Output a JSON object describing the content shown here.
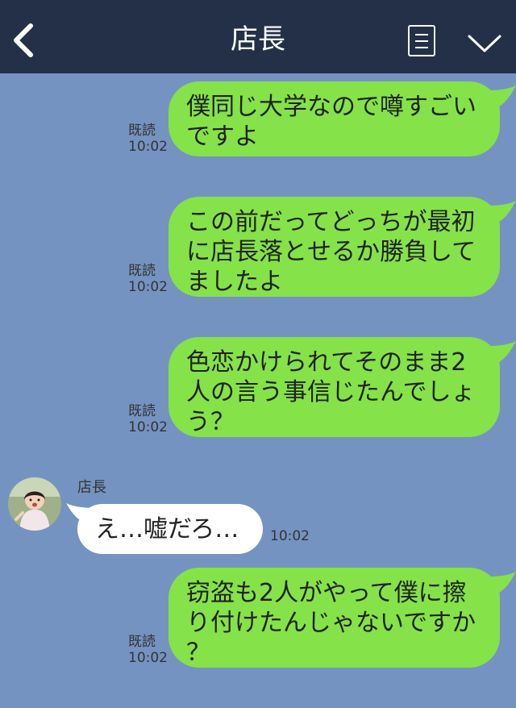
{
  "header": {
    "title": "店長"
  },
  "messages": [
    {
      "side": "right",
      "text": "僕同じ大学なので噂すごいですよ",
      "lines": [
        "僕同じ大学なので噂すごい",
        "ですよ"
      ],
      "read": "既読",
      "time": "10:02"
    },
    {
      "side": "right",
      "text": "この前だってどっちが最初に店長落とせるか勝負してましたよ",
      "lines": [
        "この前だってどっちが最初",
        "に店長落とせるか勝負して",
        "ましたよ"
      ],
      "read": "既読",
      "time": "10:02"
    },
    {
      "side": "right",
      "text": "色恋かけられてそのまま2人の言う事信じたんでしょう？",
      "lines": [
        "色恋かけられてそのまま2",
        "人の言う事信じたんでしょ",
        "う？"
      ],
      "read": "既読",
      "time": "10:02"
    },
    {
      "side": "left",
      "sender": "店長",
      "text": "え…嘘だろ…",
      "time": "10:02"
    },
    {
      "side": "right",
      "text": "窃盗も2人がやって僕に擦り付けたんじゃないですか？",
      "lines": [
        "窃盗も2人がやって僕に擦",
        "り付けたんじゃないですか",
        "？"
      ],
      "read": "既読",
      "time": "10:02"
    }
  ],
  "icons": {
    "back": "chevron-left-icon",
    "menu": "list-menu-icon",
    "collapse": "chevron-down-icon",
    "avatar": "avatar-photo"
  },
  "colors": {
    "header": "#233047",
    "background": "#7593c1",
    "sent_bubble": "#85e249",
    "received_bubble": "#ffffff"
  }
}
